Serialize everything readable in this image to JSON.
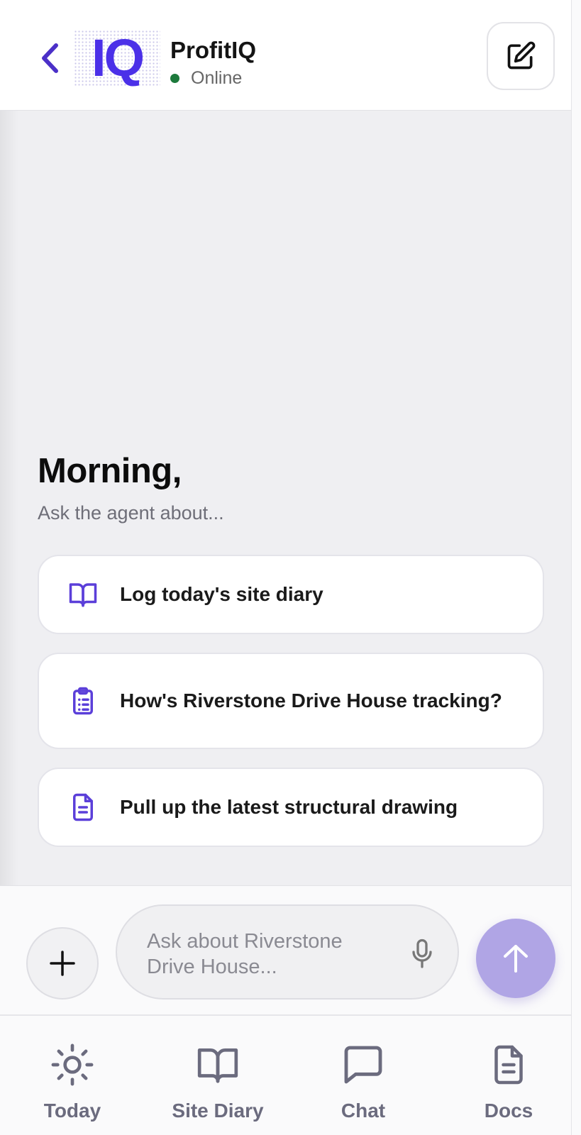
{
  "header": {
    "logo_text": "IQ",
    "title": "ProfitIQ",
    "status": "Online",
    "back_icon": "chevron-left-icon",
    "compose_icon": "edit-square-icon"
  },
  "greeting": {
    "title": "Morning,",
    "subtitle": "Ask the agent about..."
  },
  "suggestions": [
    {
      "label": "Log today's site diary",
      "icon": "book-open-icon"
    },
    {
      "label": "How's Riverstone Drive House tracking?",
      "icon": "clipboard-list-icon"
    },
    {
      "label": "Pull up the latest structural drawing",
      "icon": "document-icon"
    }
  ],
  "composer": {
    "placeholder": "Ask about Riverstone Drive House...",
    "plus_icon": "plus-icon",
    "mic_icon": "microphone-icon",
    "send_icon": "arrow-up-icon"
  },
  "nav": [
    {
      "label": "Today",
      "icon": "sun-icon"
    },
    {
      "label": "Site Diary",
      "icon": "book-open-icon"
    },
    {
      "label": "Chat",
      "icon": "chat-bubble-icon"
    },
    {
      "label": "Docs",
      "icon": "document-icon"
    }
  ],
  "colors": {
    "brand": "#4b30e8",
    "accent_icon": "#5b3fd9",
    "send_button": "#b0a5e5",
    "online": "#1d7a3c",
    "nav_text": "#6b6b7e"
  }
}
